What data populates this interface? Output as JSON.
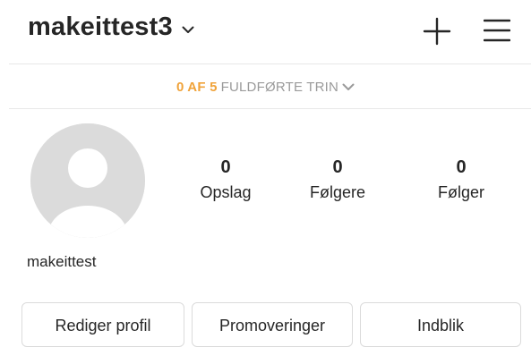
{
  "header": {
    "username": "makeittest3",
    "username_icon": "chevron-down-icon",
    "new_post_icon": "plus-icon",
    "menu_icon": "hamburger-menu-icon"
  },
  "progress": {
    "count": "0 AF 5",
    "label": "FULDFØRTE TRIN",
    "icon": "chevron-down-icon",
    "count_color": "#f0a33a",
    "label_color": "#9a9a9a"
  },
  "profile": {
    "avatar_icon": "default-avatar-icon",
    "display_name": "makeittest",
    "stats": [
      {
        "value": "0",
        "label": "Opslag"
      },
      {
        "value": "0",
        "label": "Følgere"
      },
      {
        "value": "0",
        "label": "Følger"
      }
    ]
  },
  "actions": [
    {
      "label": "Rediger profil"
    },
    {
      "label": "Promoveringer"
    },
    {
      "label": "Indblik"
    }
  ]
}
